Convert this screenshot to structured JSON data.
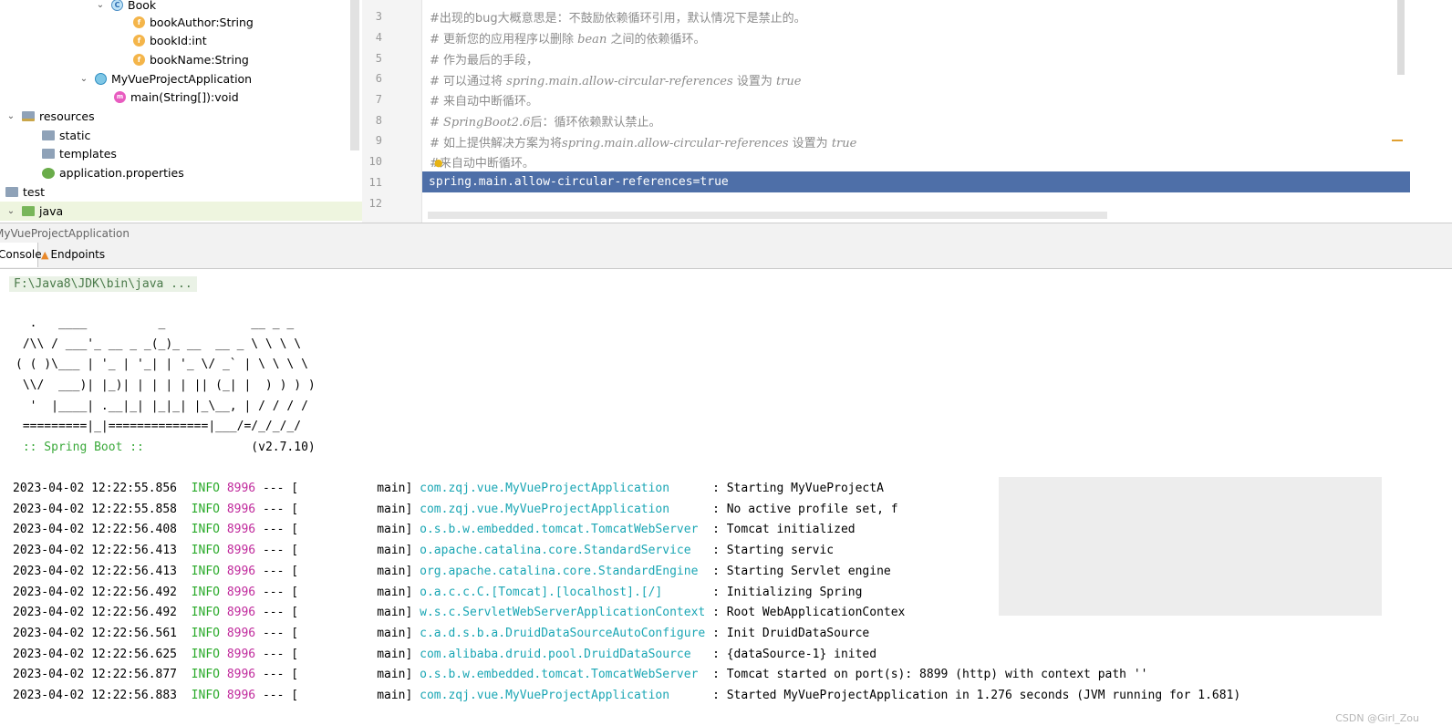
{
  "tree": {
    "items": [
      {
        "label": "Book",
        "twisty": "⌄",
        "icon": "C"
      },
      {
        "label": "bookAuthor:String",
        "icon": "f"
      },
      {
        "label": "bookId:int",
        "icon": "f"
      },
      {
        "label": "bookName:String",
        "icon": "f"
      },
      {
        "label": "MyVueProjectApplication",
        "twisty": "⌄"
      },
      {
        "label": "main(String[]):void",
        "icon": "m"
      },
      {
        "label": "resources",
        "twisty": "⌄"
      },
      {
        "label": "static"
      },
      {
        "label": "templates"
      },
      {
        "label": "application.properties"
      },
      {
        "label": "test"
      },
      {
        "label": "java",
        "twisty": "⌄"
      }
    ]
  },
  "editor": {
    "line_numbers": [
      "3",
      "4",
      "5",
      "6",
      "7",
      "8",
      "9",
      "10",
      "11",
      "12"
    ],
    "lines": {
      "l3": "#出现的bug大概意思是：不鼓励依赖循环引用，默认情况下是禁止的。",
      "l4a": "# 更新您的应用程序以删除 ",
      "l4b": "bean",
      "l4c": " 之间的依赖循环。",
      "l5": "# 作为最后的手段，",
      "l6a": "# 可以通过将 ",
      "l6b": "spring.main.allow-circular-references",
      "l6c": " 设置为 ",
      "l6d": "true",
      "l7": "# 来自动中断循环。",
      "l8a": "# ",
      "l8b": "SpringBoot2.6",
      "l8c": "后：循环依赖默认禁止。",
      "l9a": "# 如上提供解决方案为将",
      "l9b": "spring.main.allow-circular-references",
      "l9c": " 设置为 ",
      "l9d": "true",
      "l10": "#来自动中断循环。",
      "l11": "spring.main.allow-circular-references=true"
    }
  },
  "run": {
    "title": "MyVueProjectApplication",
    "tabs": {
      "console": "Console",
      "endpoints": "Endpoints"
    }
  },
  "console": {
    "command": "F:\\Java8\\JDK\\bin\\java ...",
    "banner": [
      "  .   ____          _            __ _ _",
      " /\\\\ / ___'_ __ _ _(_)_ __  __ _ \\ \\ \\ \\",
      "( ( )\\___ | '_ | '_| | '_ \\/ _` | \\ \\ \\ \\",
      " \\\\/  ___)| |_)| | | | | || (_| |  ) ) ) )",
      "  '  |____| .__|_| |_|_| |_\\__, | / / / /",
      " =========|_|==============|___/=/_/_/_/"
    ],
    "spring_boot_label": " :: Spring Boot :: ",
    "spring_boot_version": "              (v2.7.10)",
    "logs": [
      {
        "ts": "2023-04-02 12:22:55.856",
        "level": "INFO",
        "pid": "8996",
        "sep": "--- [",
        "thread": "main]",
        "logger": "com.zqj.vue.MyVueProjectApplication",
        "msg": ": Starting MyVueProjectA"
      },
      {
        "ts": "2023-04-02 12:22:55.858",
        "level": "INFO",
        "pid": "8996",
        "sep": "--- [",
        "thread": "main]",
        "logger": "com.zqj.vue.MyVueProjectApplication",
        "msg": ": No active profile set, f"
      },
      {
        "ts": "2023-04-02 12:22:56.408",
        "level": "INFO",
        "pid": "8996",
        "sep": "--- [",
        "thread": "main]",
        "logger": "o.s.b.w.embedded.tomcat.TomcatWebServer",
        "msg": ": Tomcat initialized"
      },
      {
        "ts": "2023-04-02 12:22:56.413",
        "level": "INFO",
        "pid": "8996",
        "sep": "--- [",
        "thread": "main]",
        "logger": "o.apache.catalina.core.StandardService",
        "msg": ": Starting servic"
      },
      {
        "ts": "2023-04-02 12:22:56.413",
        "level": "INFO",
        "pid": "8996",
        "sep": "--- [",
        "thread": "main]",
        "logger": "org.apache.catalina.core.StandardEngine",
        "msg": ": Starting Servlet engine"
      },
      {
        "ts": "2023-04-02 12:22:56.492",
        "level": "INFO",
        "pid": "8996",
        "sep": "--- [",
        "thread": "main]",
        "logger": "o.a.c.c.C.[Tomcat].[localhost].[/]",
        "msg": ": Initializing Spring"
      },
      {
        "ts": "2023-04-02 12:22:56.492",
        "level": "INFO",
        "pid": "8996",
        "sep": "--- [",
        "thread": "main]",
        "logger": "w.s.c.ServletWebServerApplicationContext",
        "msg": ": Root WebApplicationContex"
      },
      {
        "ts": "2023-04-02 12:22:56.561",
        "level": "INFO",
        "pid": "8996",
        "sep": "--- [",
        "thread": "main]",
        "logger": "c.a.d.s.b.a.DruidDataSourceAutoConfigure",
        "msg": ": Init DruidDataSource"
      },
      {
        "ts": "2023-04-02 12:22:56.625",
        "level": "INFO",
        "pid": "8996",
        "sep": "--- [",
        "thread": "main]",
        "logger": "com.alibaba.druid.pool.DruidDataSource",
        "msg": ": {dataSource-1} inited"
      },
      {
        "ts": "2023-04-02 12:22:56.877",
        "level": "INFO",
        "pid": "8996",
        "sep": "--- [",
        "thread": "main]",
        "logger": "o.s.b.w.embedded.tomcat.TomcatWebServer",
        "msg": ": Tomcat started on port(s): 8899 (http) with context path ''"
      },
      {
        "ts": "2023-04-02 12:22:56.883",
        "level": "INFO",
        "pid": "8996",
        "sep": "--- [",
        "thread": "main]",
        "logger": "com.zqj.vue.MyVueProjectApplication",
        "msg": ": Started MyVueProjectApplication in 1.276 seconds (JVM running for 1.681)"
      }
    ],
    "watermark": "CSDN @Girl_Zou"
  },
  "colors": {
    "selection": "#4e6fa8",
    "info": "#2aaa2a",
    "pid": "#c0299c",
    "logger": "#1aa6b4"
  }
}
